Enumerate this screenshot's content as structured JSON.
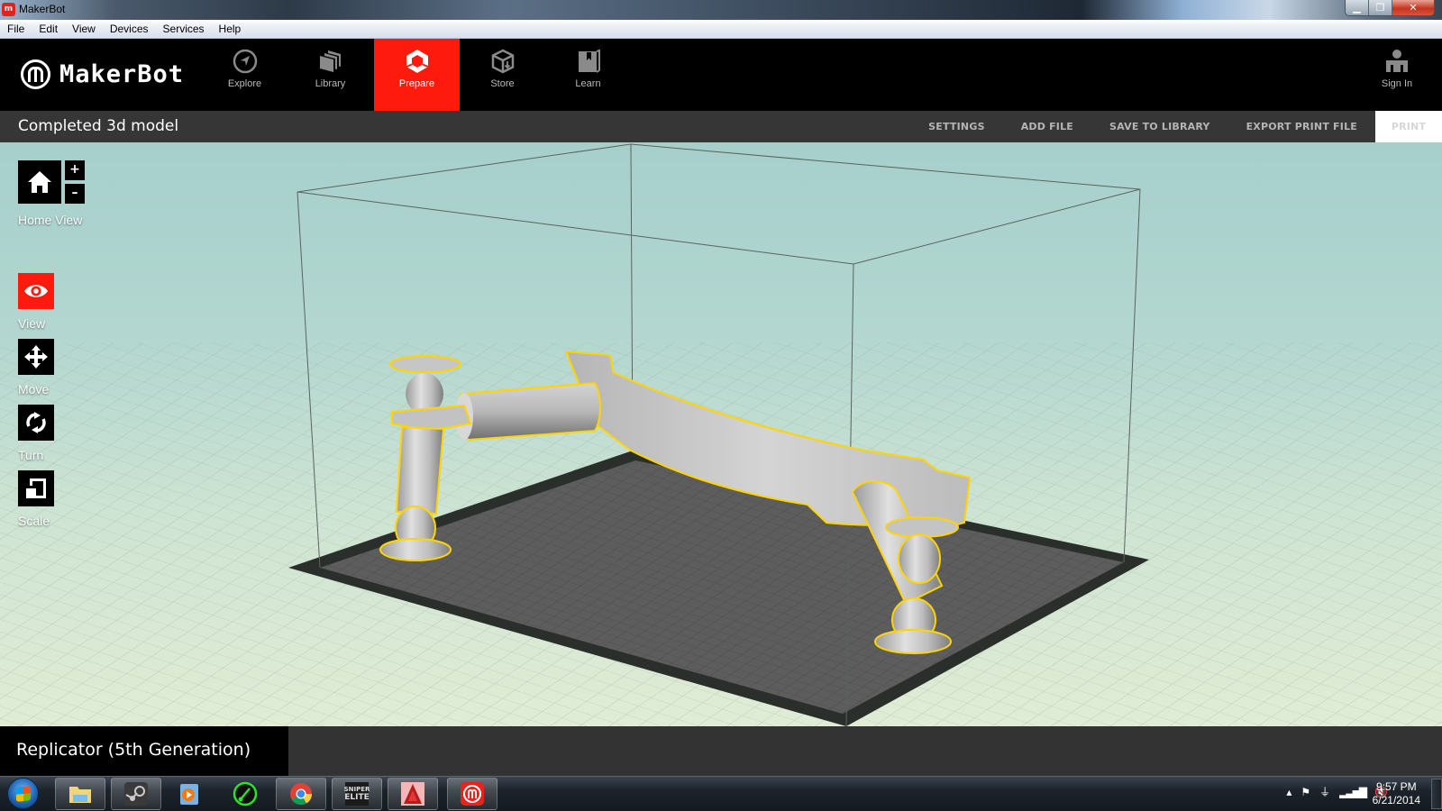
{
  "window": {
    "title": "MakerBot",
    "app_icon": "makerbot-m-icon",
    "controls": [
      "minimize",
      "restore",
      "close"
    ]
  },
  "menubar": {
    "items": [
      "File",
      "Edit",
      "View",
      "Devices",
      "Services",
      "Help"
    ]
  },
  "header": {
    "logo_text": "MakerBot",
    "nav": [
      {
        "label": "Explore",
        "icon": "compass-icon",
        "active": false
      },
      {
        "label": "Library",
        "icon": "stacked-pages-icon",
        "active": false
      },
      {
        "label": "Prepare",
        "icon": "prepare-cube-icon",
        "active": true
      },
      {
        "label": "Store",
        "icon": "box-icon",
        "active": false
      },
      {
        "label": "Learn",
        "icon": "book-bookmark-icon",
        "active": false
      }
    ],
    "signin": {
      "label": "Sign In",
      "icon": "user-icon"
    },
    "accent_color": "#ff1a0e"
  },
  "subheader": {
    "project_title": "Completed 3d model",
    "actions": [
      "SETTINGS",
      "ADD FILE",
      "SAVE TO LIBRARY",
      "EXPORT PRINT FILE",
      "PRINT"
    ]
  },
  "tools": {
    "home": {
      "label": "Home View",
      "zoom_in": "+",
      "zoom_out": "–"
    },
    "items": [
      {
        "label": "View",
        "icon": "eye-icon",
        "active": true
      },
      {
        "label": "Move",
        "icon": "move-arrows-icon",
        "active": false
      },
      {
        "label": "Turn",
        "icon": "rotate-icon",
        "active": false
      },
      {
        "label": "Scale",
        "icon": "scale-icon",
        "active": false
      }
    ]
  },
  "viewport": {
    "model_outline_color": "#ffd400",
    "model_color": "#c8c8c8",
    "build_plate_color": "#5b5b5b"
  },
  "footer": {
    "device": "Replicator (5th Generation)"
  },
  "taskbar": {
    "apps": [
      {
        "name": "windows-explorer",
        "icon": "folder-icon"
      },
      {
        "name": "steam",
        "icon": "steam-icon"
      },
      {
        "name": "media-player",
        "icon": "play-icon"
      },
      {
        "name": "razer-game-booster",
        "icon": "gauge-icon"
      },
      {
        "name": "chrome",
        "icon": "chrome-icon"
      },
      {
        "name": "sniper-elite",
        "icon": "sniper-elite-icon",
        "label": "SNIPER ELITE"
      },
      {
        "name": "autocad",
        "icon": "autocad-icon"
      },
      {
        "name": "makerbot",
        "icon": "makerbot-m-icon"
      }
    ],
    "tray": [
      "show-hidden-icon",
      "action-center-flag-icon",
      "power-plug-icon",
      "signal-bars-icon",
      "volume-muted-icon"
    ],
    "time": "9:57 PM",
    "date": "6/21/2014"
  }
}
